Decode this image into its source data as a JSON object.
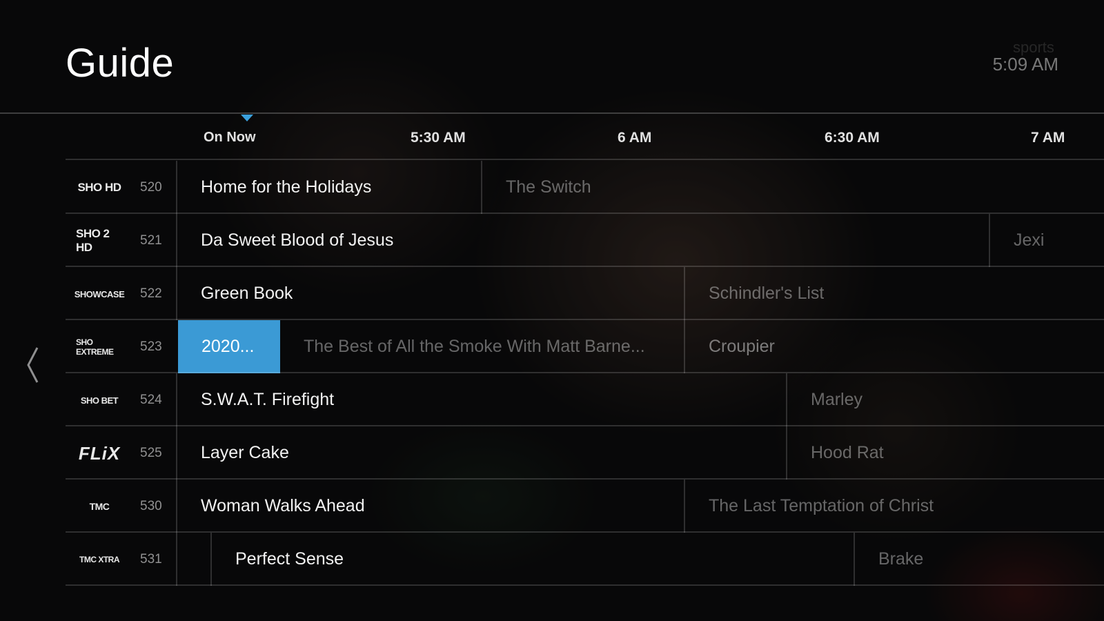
{
  "header": {
    "title": "Guide",
    "watermark": "sports",
    "clock": "5:09 AM"
  },
  "timeline": {
    "labels": [
      "On Now",
      "5:30 AM",
      "6 AM",
      "6:30 AM",
      "7 AM"
    ]
  },
  "channels": [
    {
      "number": "520",
      "logo": "SHO HD",
      "current": "Home for the Holidays",
      "next": "The Switch"
    },
    {
      "number": "521",
      "logo": "SHO 2 HD",
      "current": "Da Sweet Blood of Jesus",
      "next": "Jexi"
    },
    {
      "number": "522",
      "logo": "SHOWCASE",
      "current": "Green Book",
      "next": "Schindler's List"
    },
    {
      "number": "523",
      "logo": "SHO EXTREME",
      "selected": "2020...",
      "current": "The Best of All the Smoke With Matt Barne...",
      "next": "Croupier"
    },
    {
      "number": "524",
      "logo": "SHO BET",
      "current": "S.W.A.T. Firefight",
      "next": "Marley"
    },
    {
      "number": "525",
      "logo": "FLiX",
      "current": "Layer Cake",
      "next": "Hood Rat"
    },
    {
      "number": "530",
      "logo": "TMC",
      "current": "Woman Walks Ahead",
      "next": "The Last Temptation of Christ"
    },
    {
      "number": "531",
      "logo": "TMC XTRA",
      "current": "Perfect Sense",
      "next": "Brake"
    }
  ],
  "colors": {
    "accent": "#3b9ad5",
    "background": "#0d0d0e"
  },
  "icons": {
    "left_nav": "chevron-left-icon"
  }
}
